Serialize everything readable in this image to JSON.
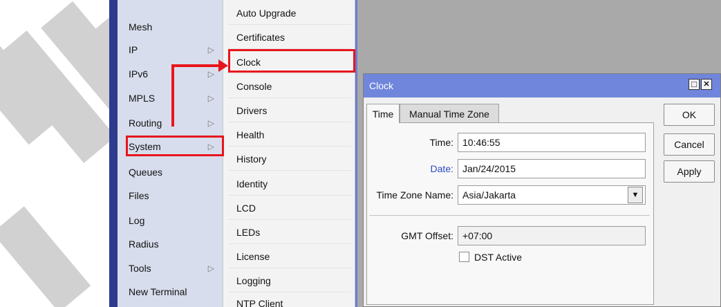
{
  "sidebar": {
    "items": [
      {
        "label": "Mesh",
        "has_submenu": false
      },
      {
        "label": "IP",
        "has_submenu": true
      },
      {
        "label": "IPv6",
        "has_submenu": true
      },
      {
        "label": "MPLS",
        "has_submenu": true
      },
      {
        "label": "Routing",
        "has_submenu": true
      },
      {
        "label": "System",
        "has_submenu": true,
        "highlighted": true
      },
      {
        "label": "Queues",
        "has_submenu": false
      },
      {
        "label": "Files",
        "has_submenu": false
      },
      {
        "label": "Log",
        "has_submenu": false
      },
      {
        "label": "Radius",
        "has_submenu": false
      },
      {
        "label": "Tools",
        "has_submenu": true
      },
      {
        "label": "New Terminal",
        "has_submenu": false
      }
    ],
    "submenu_arrow_glyph": "▷"
  },
  "submenu": {
    "items": [
      {
        "label": "Auto Upgrade"
      },
      {
        "label": "Certificates"
      },
      {
        "label": "Clock",
        "highlighted": true
      },
      {
        "label": "Console"
      },
      {
        "label": "Drivers"
      },
      {
        "label": "Health"
      },
      {
        "label": "History"
      },
      {
        "label": "Identity"
      },
      {
        "label": "LCD"
      },
      {
        "label": "LEDs"
      },
      {
        "label": "License"
      },
      {
        "label": "Logging"
      },
      {
        "label": "NTP Client"
      }
    ]
  },
  "clock_window": {
    "title": "Clock",
    "restore_glyph": "□",
    "close_glyph": "✕",
    "tabs": [
      {
        "label": "Time",
        "active": true
      },
      {
        "label": "Manual Time Zone",
        "active": false
      }
    ],
    "fields": {
      "time_label": "Time:",
      "time_value": "10:46:55",
      "date_label": "Date:",
      "date_value": "Jan/24/2015",
      "tz_label": "Time Zone Name:",
      "tz_value": "Asia/Jakarta",
      "tz_dropdown_glyph": "▼",
      "gmt_label": "GMT Offset:",
      "gmt_value": "+07:00",
      "dst_label": "DST Active",
      "dst_checked": false
    },
    "buttons": {
      "ok": "OK",
      "cancel": "Cancel",
      "apply": "Apply"
    }
  },
  "colors": {
    "highlight_red": "#e8141c",
    "title_bar": "#6f86dc",
    "date_label_blue": "#2b48c8",
    "left_panel": "#d7ddec",
    "left_strip": "#2e3a8c",
    "workspace": "#a9a9a9"
  }
}
